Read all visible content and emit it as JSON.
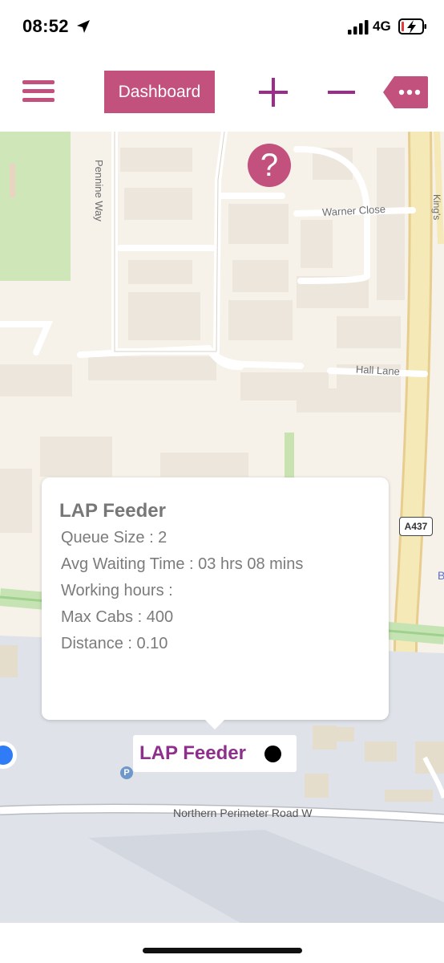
{
  "status_bar": {
    "time": "08:52",
    "network": "4G"
  },
  "toolbar": {
    "dashboard_label": "Dashboard",
    "accent_color": "#c2517e",
    "icon_color": "#9b2c8c"
  },
  "map": {
    "help_label": "?",
    "road_labels": {
      "pennine_way": "Pennine Way",
      "warner_close": "Warner Close",
      "hall_lane": "Hall Lane",
      "northern_perimeter": "Northern Perimeter Road W",
      "kings": "King's"
    },
    "road_shield": "A437",
    "parking_symbol": "P",
    "edge_letter": "B"
  },
  "popup": {
    "title": "LAP Feeder",
    "lines": [
      "Queue Size : 2",
      "Avg Waiting Time : 03 hrs 08 mins",
      "Working hours :",
      "Max Cabs : 400",
      "Distance : 0.10"
    ]
  },
  "marker": {
    "label": "LAP Feeder"
  }
}
